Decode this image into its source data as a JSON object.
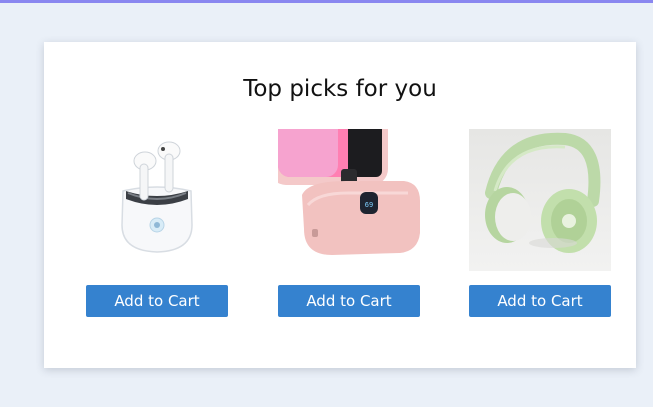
{
  "section": {
    "title": "Top picks for you"
  },
  "products": [
    {
      "icon": "wireless-earbuds-image",
      "button_label": "Add to Cart"
    },
    {
      "icon": "pink-power-bank-image",
      "button_label": "Add to Cart"
    },
    {
      "icon": "green-headphones-image",
      "button_label": "Add to Cart"
    }
  ],
  "colors": {
    "accent": "#3582cf",
    "page_bg": "#eaf0f8",
    "card_bg": "#ffffff",
    "top_strip": "#8a87f0"
  }
}
